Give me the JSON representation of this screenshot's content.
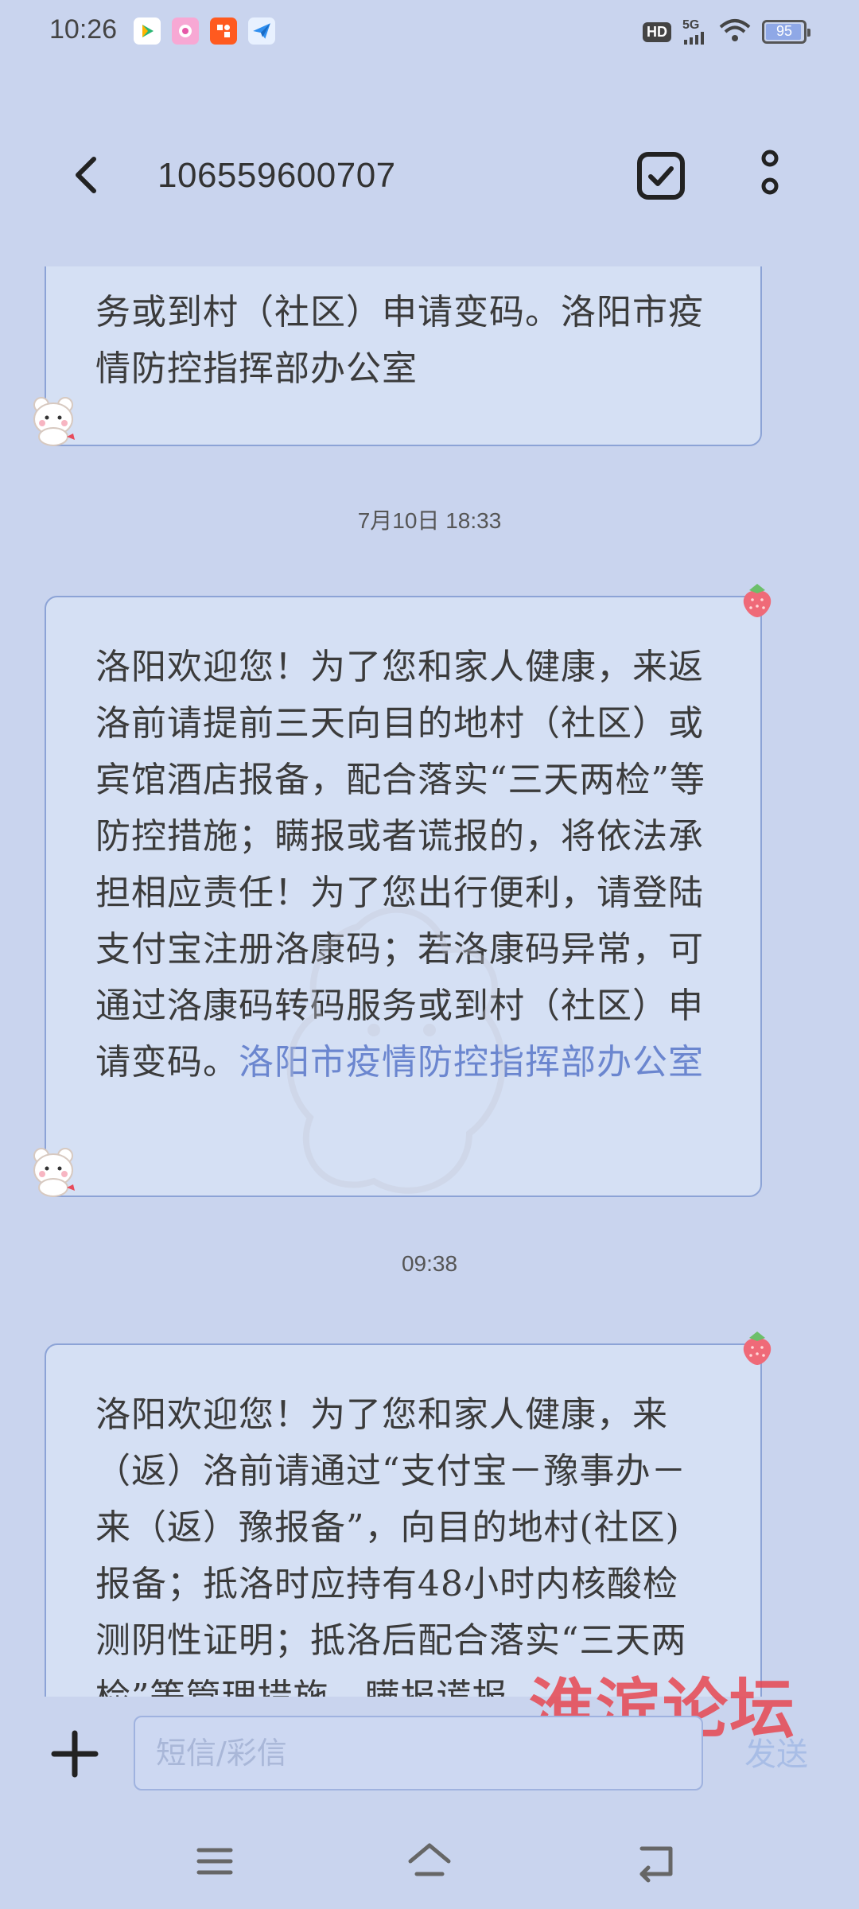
{
  "status_bar": {
    "time": "10:26",
    "hd": "HD",
    "network": "5G",
    "battery": "95",
    "battery_level": 0.95
  },
  "header": {
    "title": "106559600707"
  },
  "messages": {
    "msg1_partial": "务或到村（社区）申请变码。洛阳市疫情防控指挥部办公室",
    "timestamp1": "7月10日 18:33",
    "msg2_text": "洛阳欢迎您！为了您和家人健康，来返洛前请提前三天向目的地村（社区）或宾馆酒店报备，配合落实“三天两检”等防控措施；瞒报或者谎报的，将依法承担相应责任！为了您出行便利，请登陆支付宝注册洛康码；若洛康码异常，可通过洛康码转码服务或到村（社区）申请变码。",
    "msg2_link": "洛阳市疫情防控指挥部办公室",
    "timestamp2": "09:38",
    "msg3_text": "洛阳欢迎您！为了您和家人健康，来（返）洛前请通过“支付宝－豫事办－来（返）豫报备”，向目的地村(社区)报备；抵洛时应持有48小时内核酸检测阴性证明；抵洛后配合落实“三天两检”等管理措施，瞒报谎报"
  },
  "input": {
    "placeholder": "短信/彩信",
    "send_label": "发送"
  },
  "watermark_text": "淮滨论坛",
  "colors": {
    "background": "#c9d4ee",
    "bubble": "#d5e0f4",
    "bubble_border": "#8ca3d6",
    "link": "#6b86cf"
  }
}
